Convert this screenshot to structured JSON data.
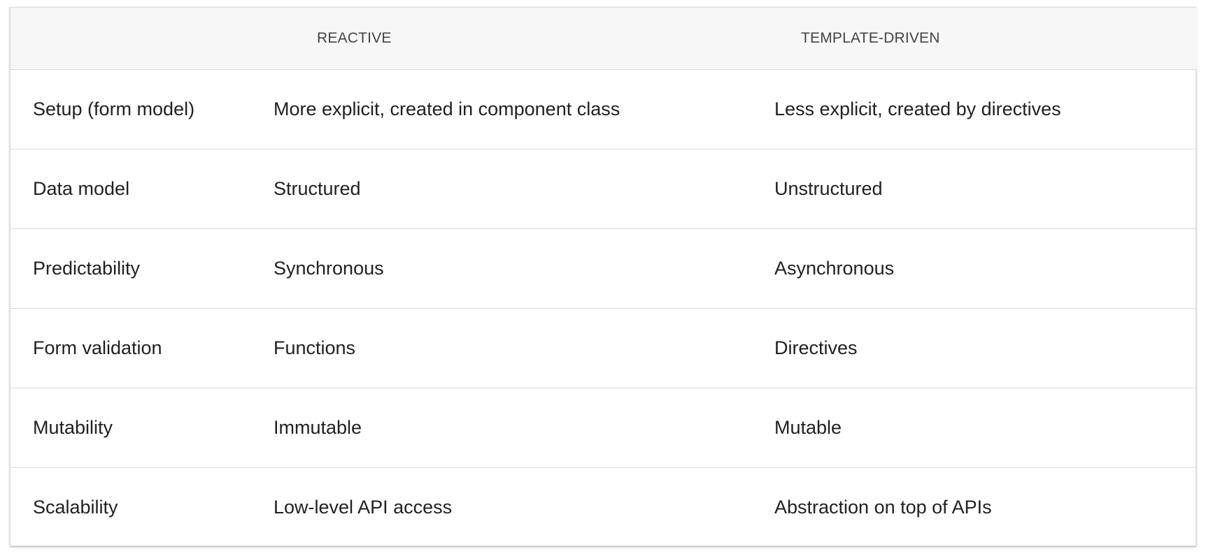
{
  "table": {
    "headers": {
      "feature": "",
      "reactive": "REACTIVE",
      "template": "TEMPLATE-DRIVEN"
    },
    "rows": [
      {
        "feature": "Setup (form model)",
        "reactive": "More explicit, created in component class",
        "template": "Less explicit, created by directives"
      },
      {
        "feature": "Data model",
        "reactive": "Structured",
        "template": "Unstructured"
      },
      {
        "feature": "Predictability",
        "reactive": "Synchronous",
        "template": "Asynchronous"
      },
      {
        "feature": "Form validation",
        "reactive": "Functions",
        "template": "Directives"
      },
      {
        "feature": "Mutability",
        "reactive": "Immutable",
        "template": "Mutable"
      },
      {
        "feature": "Scalability",
        "reactive": "Low-level API access",
        "template": "Abstraction on top of APIs"
      }
    ]
  }
}
